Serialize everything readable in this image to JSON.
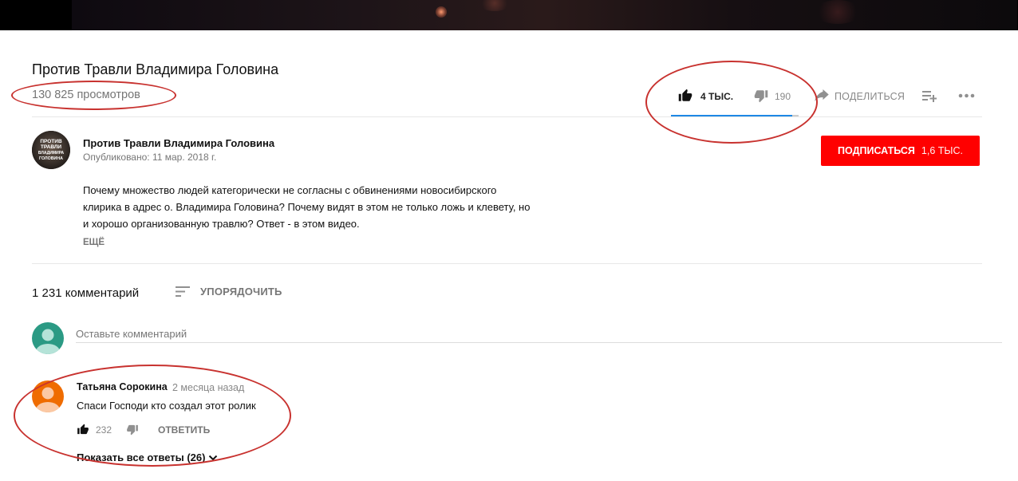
{
  "video": {
    "title": "Против Травли Владимира Головина",
    "views": "130 825 просмотров"
  },
  "actions": {
    "likes": "4 ТЫС.",
    "dislikes": "190",
    "share": "ПОДЕЛИТЬСЯ",
    "like_ratio": 0.95
  },
  "channel": {
    "name": "Против Травли Владимира Головина",
    "published": "Опубликовано: 11 мар. 2018 г.",
    "avatar_text": "ПРОТИВ ТРАВЛИ ВЛАДИМИРА ГОЛОВИНА",
    "subscribe_label": "ПОДПИСАТЬСЯ",
    "subscriber_count": "1,6 ТЫС."
  },
  "description": {
    "lines": [
      "Почему множество людей категорически не согласны с обвинениями новосибирского",
      "клирика в адрес о. Владимира Головина? Почему видят в этом не только ложь и клевету, но",
      "и хорошо организованную травлю? Ответ - в этом видео."
    ],
    "more_label": "ЕЩЁ"
  },
  "comments": {
    "count_label": "1 231 комментарий",
    "sort_label": "УПОРЯДОЧИТЬ",
    "input_placeholder": "Оставьте комментарий",
    "items": [
      {
        "author": "Татьяна Сорокина",
        "time": "2 месяца назад",
        "text": "Спаси Господи кто создал этот ролик",
        "likes": "232",
        "reply_label": "ОТВЕТИТЬ",
        "show_replies": "Показать все ответы (26)"
      }
    ]
  },
  "colors": {
    "subscribe": "#ff0000",
    "sentiment": "#1e88e5",
    "annotation": "#c8322f",
    "user_avatar": "#2b9a84",
    "commenter_avatar": "#ef6c00"
  },
  "icons": [
    "thumb-up-icon",
    "thumb-down-icon",
    "share-icon",
    "add-to-playlist-icon",
    "more-icon",
    "sort-icon",
    "chevron-down-icon"
  ]
}
